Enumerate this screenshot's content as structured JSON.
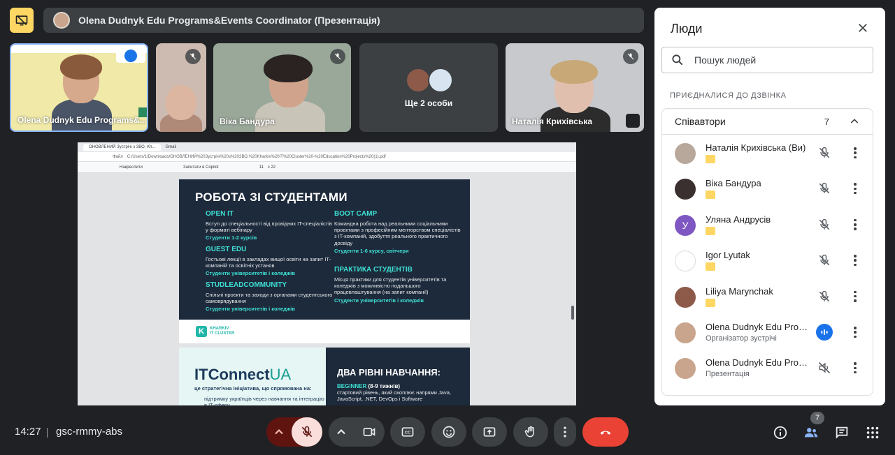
{
  "header": {
    "presenting_icon": "present-off-icon",
    "title": "Olena Dudnyk Edu Programs&Events Coordinator (Презентація)"
  },
  "tiles": [
    {
      "name": "Olena Dudnyk Edu Programs&...",
      "speaking": true
    },
    {
      "name": "",
      "muted": true
    },
    {
      "name": "Віка Бандура",
      "muted": true
    },
    {
      "name": "Ще 2 особи",
      "muted": false
    },
    {
      "name": "Наталія Крихівська",
      "muted": true
    }
  ],
  "shared_screen": {
    "browser_tabs": [
      "ОНОВЛЕНИЙ Зустрічі з ЗВО, Kh...",
      "Gmail"
    ],
    "url": "C:/Users/1/Downloads/ОНОВЛЕНИЙ%20Зустрічі%20з%20ЗВО,%20Kharkiv%20IT%20Cluster%20-%20Education%20Projects%20(1).pdf",
    "url_prefix": "Файл",
    "toolbar_draw": "Накреслити",
    "toolbar_ask": "Запитати в Copilot",
    "page_current": "11",
    "page_total": "з 22",
    "slide1": {
      "title": "РОБОТА ЗІ СТУДЕНТАМИ",
      "sections": [
        {
          "heading": "OPEN IT",
          "text": "Вступ до спеціальності від провідних IT-спеціалістів у форматі вебінару",
          "audience": "Студенти 1-2 курсів"
        },
        {
          "heading": "GUEST EDU",
          "text": "Гостьові лекції в закладах вищої освіти на запит IT-компаній та освітніх установ",
          "audience": "Студенти університетів і коледжів"
        },
        {
          "heading": "STUDLEADCOMMUNITY",
          "text": "Спільні проєкти та заходи з органами студентського самоврядування",
          "audience": "Студенти університетів і коледжів"
        },
        {
          "heading": "BOOT CAMP",
          "text": "Командна робота над реальними соціальними проєктами з професійним менторством спеціалістів з IT-компаній, здобуття реального практичного досвіду",
          "audience": "Студенти 1-6 курсу, світчери"
        },
        {
          "heading": "ПРАКТИКА СТУДЕНТІВ",
          "text": "Місця практики для студентів університетів та коледжів з можливістю подальшого працевлаштування (на запит компанії)",
          "audience": "Студенти університетів і коледжів"
        }
      ],
      "logo_text_1": "KHARKIV",
      "logo_text_2": "IT CLUSTER"
    },
    "slide2": {
      "brand_a": "IT",
      "brand_b": "Connect",
      "brand_c": "UA",
      "subtitle": "це стратегічна ініціатива, що спрямована на:",
      "bullet": "підтримку українців через навчання та інтеграцію в IT-сферу",
      "right_heading": "ДВА РІВНІ НАВЧАННЯ:",
      "level_name": "BEGINNER",
      "level_weeks": "(8-9 тижнів)",
      "level_text": "стартовий рівень, який охоплює напрями Java, JavaScript, .NET, DevOps і Software"
    }
  },
  "people_panel": {
    "title": "Люди",
    "search_placeholder": "Пошук людей",
    "section_label": "ПРИЄДНАЛИСЯ ДО ДЗВІНКА",
    "group_name": "Співавтори",
    "group_count": "7",
    "participants": [
      {
        "name": "Наталія Крихівська (Ви)",
        "sub": "",
        "badge": true,
        "mic": "muted",
        "avatar_color": "#b8a89c",
        "initial": ""
      },
      {
        "name": "Віка Бандура",
        "sub": "",
        "badge": true,
        "mic": "muted",
        "avatar_color": "#3b3030",
        "initial": ""
      },
      {
        "name": "Уляна Андрусів",
        "sub": "",
        "badge": true,
        "mic": "muted",
        "avatar_color": "#7e57c2",
        "initial": "У"
      },
      {
        "name": "Igor Lyutak",
        "sub": "",
        "badge": true,
        "mic": "muted",
        "avatar_color": "#ffffff",
        "initial": ""
      },
      {
        "name": "Liliya Marynchak",
        "sub": "",
        "badge": true,
        "mic": "muted",
        "avatar_color": "#8d5a4a",
        "initial": ""
      },
      {
        "name": "Olena Dudnyk Edu Prog...",
        "sub": "Організатор зустрічі",
        "badge": false,
        "mic": "speaking",
        "avatar_color": "#c9a58d",
        "initial": ""
      },
      {
        "name": "Olena Dudnyk Edu Prog...",
        "sub": "Презентація",
        "badge": false,
        "mic": "presenting",
        "avatar_color": "#c9a58d",
        "initial": ""
      }
    ]
  },
  "bottom_bar": {
    "time": "14:27",
    "meeting_code": "gsc-rmmy-abs",
    "people_count": "7"
  },
  "colors": {
    "background": "#202124",
    "panel": "#ffffff",
    "accent_yellow": "#fdd663",
    "end_call": "#ea4335",
    "mic_off_bg": "#f9dedc",
    "speaking_blue": "#1a73e8",
    "slide_teal": "#3ee0d4",
    "slide_navy": "#1d2a3b"
  }
}
